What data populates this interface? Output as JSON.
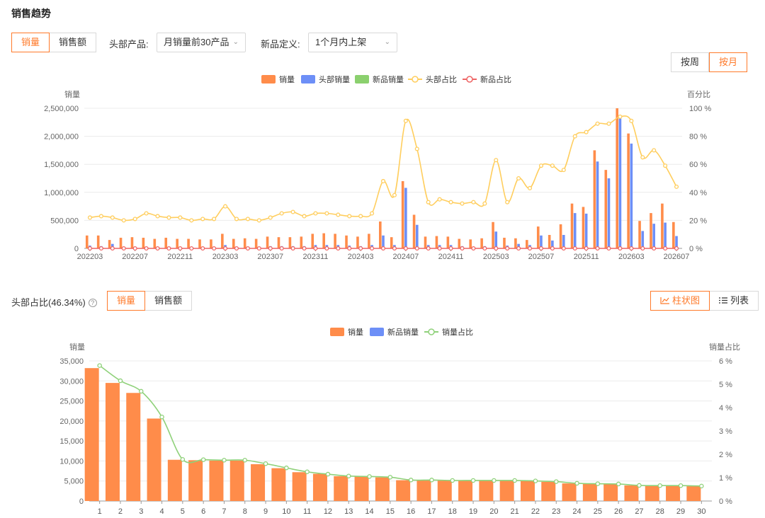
{
  "page": {
    "title": "销售趋势"
  },
  "top_controls": {
    "metric_tabs": [
      "销量",
      "销售额"
    ],
    "head_label": "头部产品:",
    "head_value": "月销量前30产品",
    "new_label": "新品定义:",
    "new_value": "1个月内上架",
    "period_tabs": [
      "按周",
      "按月"
    ]
  },
  "bottom_controls": {
    "share_label": "头部占比(46.34%)",
    "metric_tabs": [
      "销量",
      "销售额"
    ],
    "view_tabs": [
      "柱状图",
      "列表"
    ]
  },
  "colors": {
    "accent": "#ff7a2a",
    "sales": "#ff8c4a",
    "head": "#6d8ff7",
    "new": "#8bd06e",
    "head_share": "#ffce5e",
    "new_share": "#ee6464",
    "volume_share": "#8fd17a"
  },
  "chart_data": [
    {
      "type": "bar",
      "legend": [
        "销量",
        "头部销量",
        "新品销量",
        "头部占比",
        "新品占比"
      ],
      "ylabel": "销量",
      "y2label": "百分比",
      "y_ticks": [
        "0",
        "500,000",
        "1,000,000",
        "1,500,000",
        "2,000,000",
        "2,500,000"
      ],
      "y2_ticks": [
        "0 %",
        "20 %",
        "40 %",
        "60 %",
        "80 %",
        "100 %"
      ],
      "ylim": [
        0,
        2500000
      ],
      "y2lim": [
        0,
        100
      ],
      "x_tick_labels": [
        "202203",
        "202207",
        "202211",
        "202303",
        "202307",
        "202311",
        "202403",
        "202407",
        "202411",
        "202503",
        "202507",
        "202511",
        "202603",
        "202607"
      ],
      "categories": [
        "202203",
        "202204",
        "202205",
        "202206",
        "202207",
        "202208",
        "202209",
        "202210",
        "202211",
        "202212",
        "202301",
        "202302",
        "202303",
        "202304",
        "202305",
        "202306",
        "202307",
        "202308",
        "202309",
        "202310",
        "202311",
        "202312",
        "202401",
        "202402",
        "202403",
        "202404",
        "202405",
        "202406",
        "202407",
        "202408",
        "202409",
        "202410",
        "202411",
        "202412",
        "202501",
        "202502",
        "202503",
        "202504",
        "202505",
        "202506",
        "202507",
        "202508",
        "202509",
        "202510",
        "202511",
        "202512",
        "202601",
        "202602",
        "202603",
        "202604",
        "202605",
        "202606",
        "202607"
      ],
      "series": [
        {
          "name": "销量",
          "kind": "bar",
          "values": [
            230000,
            230000,
            150000,
            190000,
            200000,
            190000,
            170000,
            190000,
            170000,
            170000,
            160000,
            160000,
            260000,
            170000,
            180000,
            170000,
            210000,
            200000,
            200000,
            210000,
            260000,
            270000,
            260000,
            230000,
            210000,
            260000,
            480000,
            200000,
            1200000,
            600000,
            210000,
            220000,
            210000,
            170000,
            160000,
            180000,
            470000,
            190000,
            180000,
            150000,
            390000,
            240000,
            430000,
            800000,
            740000,
            1750000,
            1400000,
            2500000,
            2050000,
            490000,
            630000,
            800000,
            470000
          ]
        },
        {
          "name": "头部销量",
          "kind": "bar",
          "values": [
            50000,
            40000,
            80000,
            30000,
            30000,
            30000,
            20000,
            30000,
            20000,
            20000,
            20000,
            20000,
            60000,
            30000,
            30000,
            20000,
            40000,
            40000,
            40000,
            40000,
            60000,
            60000,
            60000,
            50000,
            40000,
            60000,
            230000,
            60000,
            1080000,
            420000,
            60000,
            60000,
            60000,
            40000,
            30000,
            40000,
            300000,
            50000,
            80000,
            60000,
            230000,
            140000,
            240000,
            630000,
            620000,
            1550000,
            1250000,
            2320000,
            1870000,
            310000,
            440000,
            460000,
            220000
          ]
        },
        {
          "name": "新品销量",
          "kind": "bar",
          "values": [
            0,
            0,
            0,
            0,
            0,
            0,
            0,
            0,
            0,
            0,
            0,
            0,
            0,
            0,
            0,
            0,
            0,
            0,
            0,
            0,
            0,
            0,
            0,
            0,
            0,
            0,
            0,
            0,
            0,
            0,
            0,
            0,
            0,
            0,
            0,
            0,
            0,
            0,
            0,
            0,
            0,
            0,
            0,
            0,
            0,
            0,
            0,
            0,
            0,
            0,
            0,
            0,
            0
          ]
        },
        {
          "name": "头部占比",
          "kind": "line",
          "values": [
            22,
            23,
            22,
            20,
            21,
            25,
            23,
            22,
            22,
            20,
            21,
            21,
            30,
            21,
            21,
            20,
            22,
            25,
            26,
            23,
            25,
            25,
            24,
            23,
            23,
            25,
            48,
            38,
            91,
            71,
            33,
            35,
            33,
            32,
            33,
            32,
            63,
            33,
            50,
            43,
            59,
            59,
            56,
            80,
            83,
            89,
            89,
            94,
            91,
            65,
            70,
            59,
            44
          ]
        },
        {
          "name": "新品占比",
          "kind": "line",
          "values": [
            0,
            0,
            0,
            0,
            0,
            0,
            0,
            0,
            0,
            0,
            0,
            0,
            0,
            0,
            0,
            0,
            0,
            0,
            0,
            0,
            0,
            0,
            0,
            0,
            0,
            0,
            0,
            0,
            0,
            0,
            0,
            0,
            0,
            0,
            0,
            0,
            0,
            0,
            0,
            0,
            0,
            0,
            0,
            0,
            0,
            0,
            0,
            0,
            0,
            0,
            0,
            0,
            0
          ]
        }
      ]
    },
    {
      "type": "bar",
      "legend": [
        "销量",
        "新品销量",
        "销量占比"
      ],
      "ylabel": "销量",
      "y2label": "销量占比",
      "y_ticks": [
        "0",
        "5,000",
        "10,000",
        "15,000",
        "20,000",
        "25,000",
        "30,000",
        "35,000"
      ],
      "y2_ticks": [
        "0 %",
        "1 %",
        "2 %",
        "3 %",
        "4 %",
        "5 %",
        "6 %"
      ],
      "ylim": [
        0,
        35000
      ],
      "y2lim": [
        0,
        6
      ],
      "categories": [
        "1",
        "2",
        "3",
        "4",
        "5",
        "6",
        "7",
        "8",
        "9",
        "10",
        "11",
        "12",
        "13",
        "14",
        "15",
        "16",
        "17",
        "18",
        "19",
        "20",
        "21",
        "22",
        "23",
        "24",
        "25",
        "26",
        "27",
        "28",
        "29",
        "30"
      ],
      "series": [
        {
          "name": "销量",
          "kind": "bar",
          "values": [
            33200,
            29500,
            27000,
            20600,
            10300,
            10200,
            10100,
            10100,
            9200,
            8200,
            7200,
            6800,
            6200,
            6100,
            5900,
            5200,
            5200,
            5100,
            5100,
            5100,
            5100,
            5000,
            4800,
            4400,
            4300,
            4200,
            3900,
            3800,
            3800,
            3700
          ]
        },
        {
          "name": "新品销量",
          "kind": "bar",
          "values": [
            0,
            0,
            0,
            0,
            0,
            0,
            0,
            0,
            0,
            0,
            0,
            0,
            0,
            0,
            0,
            0,
            0,
            0,
            0,
            0,
            0,
            0,
            0,
            0,
            0,
            0,
            0,
            0,
            0,
            0
          ]
        },
        {
          "name": "销量占比",
          "kind": "line",
          "values": [
            5.8,
            5.15,
            4.7,
            3.6,
            1.78,
            1.77,
            1.75,
            1.75,
            1.6,
            1.42,
            1.25,
            1.15,
            1.07,
            1.05,
            1.02,
            0.9,
            0.9,
            0.88,
            0.88,
            0.88,
            0.88,
            0.86,
            0.83,
            0.76,
            0.74,
            0.73,
            0.67,
            0.66,
            0.66,
            0.64
          ]
        }
      ]
    }
  ]
}
